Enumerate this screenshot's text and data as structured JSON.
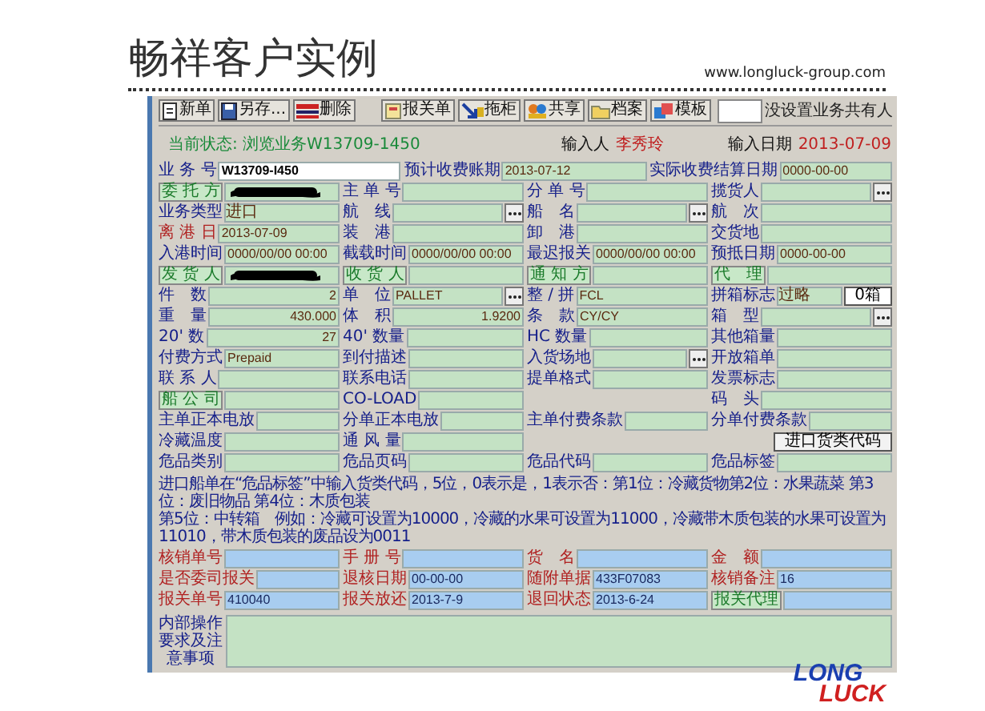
{
  "slide": {
    "title": "畅祥客户实例",
    "url": "www.longluck-group.com"
  },
  "toolbar": {
    "buttons": [
      "新单",
      "另存...",
      "删除",
      "报关单",
      "拖柜",
      "共享",
      "档案",
      "模板"
    ],
    "owner_note": "没设置业务共有人"
  },
  "status": {
    "text": "当前状态: 浏览业务W13709-1450",
    "input_by_label": "输入人",
    "input_by": "李秀玲",
    "input_date_label": "输入日期",
    "input_date": "2013-07-09"
  },
  "form_rows": [
    {
      "pairs": [
        {
          "kind": "field",
          "label": "业 务 号",
          "value": "W13709-I450",
          "focused": true
        },
        {
          "kind": "field",
          "label": "预计收费账期",
          "value": "2013-07-12"
        },
        {
          "kind": "field",
          "label": "实际收费结算日期",
          "value": "0000-00-00"
        }
      ]
    },
    {
      "pairs": [
        {
          "kind": "party",
          "label": "委 托 方",
          "redacted": true
        },
        {
          "kind": "field",
          "label": "主 单 号"
        },
        {
          "kind": "field",
          "label": "分 单 号"
        },
        {
          "kind": "field",
          "label": "揽货人",
          "browse": true
        }
      ]
    },
    {
      "pairs": [
        {
          "kind": "field",
          "label": "业务类型",
          "value": "进口"
        },
        {
          "kind": "field",
          "label": "航　线",
          "browse": true
        },
        {
          "kind": "field",
          "label": "船　名",
          "browse": true
        },
        {
          "kind": "field",
          "label": "航　次"
        }
      ]
    },
    {
      "pairs": [
        {
          "kind": "alert",
          "label": "离 港 日",
          "value": "2013-07-09"
        },
        {
          "kind": "field",
          "label": "装　港"
        },
        {
          "kind": "field",
          "label": "卸　港"
        },
        {
          "kind": "field",
          "label": "交货地"
        }
      ]
    },
    {
      "pairs": [
        {
          "kind": "field",
          "label": "入港时间",
          "value": "0000/00/00 00:00"
        },
        {
          "kind": "field",
          "label": "截载时间",
          "value": "0000/00/00 00:00"
        },
        {
          "kind": "field",
          "label": "最迟报关",
          "value": "0000/00/00 00:00"
        },
        {
          "kind": "field",
          "label": "预抵日期",
          "value": "0000-00-00"
        }
      ]
    },
    {
      "pairs": [
        {
          "kind": "party",
          "label": "发 货 人",
          "redacted": true
        },
        {
          "kind": "party",
          "label": "收 货 人"
        },
        {
          "kind": "party",
          "label": "通 知 方"
        },
        {
          "kind": "party",
          "label": "代　理"
        }
      ]
    },
    {
      "pairs": [
        {
          "kind": "field",
          "label": "件　数",
          "value": "2",
          "numeric": true
        },
        {
          "kind": "field",
          "label": "单　位",
          "value": "PALLET",
          "browse": true
        },
        {
          "kind": "field",
          "label": "整 / 拼",
          "value": "FCL"
        },
        {
          "kind": "field",
          "label": "拼箱标志",
          "value": "过略",
          "extra_button": "0箱"
        }
      ]
    },
    {
      "pairs": [
        {
          "kind": "field",
          "label": "重　量",
          "value": "430.000",
          "numeric": true
        },
        {
          "kind": "field",
          "label": "体　积",
          "value": "1.9200",
          "numeric": true
        },
        {
          "kind": "field",
          "label": "条　款",
          "value": "CY/CY"
        },
        {
          "kind": "field",
          "label": "箱　型",
          "browse": true
        }
      ]
    },
    {
      "pairs": [
        {
          "kind": "field",
          "label": "20' 数",
          "value": "27",
          "numeric": true
        },
        {
          "kind": "field",
          "label": "40' 数量"
        },
        {
          "kind": "field",
          "label": "HC 数量"
        },
        {
          "kind": "field",
          "label": "其他箱量"
        }
      ]
    },
    {
      "pairs": [
        {
          "kind": "field",
          "label": "付费方式",
          "value": "Prepaid"
        },
        {
          "kind": "field",
          "label": "到付描述"
        },
        {
          "kind": "field",
          "label": "入货场地",
          "browse": true
        },
        {
          "kind": "field",
          "label": "开放箱单"
        }
      ]
    },
    {
      "pairs": [
        {
          "kind": "field",
          "label": "联 系 人"
        },
        {
          "kind": "field",
          "label": "联系电话"
        },
        {
          "kind": "field",
          "label": "提单格式"
        },
        {
          "kind": "field",
          "label": "发票标志"
        }
      ]
    },
    {
      "pairs": [
        {
          "kind": "party",
          "label": "船 公 司"
        },
        {
          "kind": "field",
          "label": "CO-LOAD"
        },
        {
          "kind": "spacer"
        },
        {
          "kind": "field",
          "label": "码　头"
        }
      ]
    },
    {
      "pairs": [
        {
          "kind": "field",
          "label": "主单正本电放"
        },
        {
          "kind": "field",
          "label": "分单正本电放"
        },
        {
          "kind": "field",
          "label": "主单付费条款"
        },
        {
          "kind": "field",
          "label": "分单付费条款"
        }
      ]
    },
    {
      "pairs": [
        {
          "kind": "field",
          "label": "冷藏温度"
        },
        {
          "kind": "field",
          "label": "通 风 量"
        },
        {
          "kind": "spacer"
        },
        {
          "kind": "action",
          "label": "进口货类代码"
        }
      ]
    },
    {
      "pairs": [
        {
          "kind": "field",
          "label": "危品类别"
        },
        {
          "kind": "field",
          "label": "危品页码"
        },
        {
          "kind": "field",
          "label": "危品代码"
        },
        {
          "kind": "field",
          "label": "危品标签"
        }
      ]
    }
  ],
  "notes": [
    "进口船单在“危品标签”中输入货类代码，5位，0表示是，1表示否：第1位：冷藏货物第2位：水果蔬菜 第3位：废旧物品 第4位：木质包装",
    "第5位：中转箱　例如：冷藏可设置为10000，冷藏的水果可设置为11000，冷藏带木质包装的水果可设置为11010，带木质包装的废品设为0011"
  ],
  "customs_rows": [
    {
      "pairs": [
        {
          "kind": "alert",
          "label": "核销单号"
        },
        {
          "kind": "alert",
          "label": "手 册 号"
        },
        {
          "kind": "alert",
          "label": "货　名"
        },
        {
          "kind": "alert",
          "label": "金　额"
        }
      ]
    },
    {
      "pairs": [
        {
          "kind": "alert",
          "label": "是否委司报关"
        },
        {
          "kind": "alert",
          "label": "退核日期",
          "value": "00-00-00"
        },
        {
          "kind": "alert",
          "label": "随附单据",
          "value": "433F07083"
        },
        {
          "kind": "alert",
          "label": "核销备注",
          "value": "16"
        }
      ]
    },
    {
      "pairs": [
        {
          "kind": "alert",
          "label": "报关单号",
          "value": "410040"
        },
        {
          "kind": "alert",
          "label": "报关放还",
          "value": "2013-7-9"
        },
        {
          "kind": "alert",
          "label": "退回状态",
          "value": "2013-6-24"
        },
        {
          "kind": "party",
          "label": "报关代理"
        }
      ]
    }
  ],
  "remarks": {
    "label": "内部操作要求及注意事项"
  },
  "logo": {
    "line1": "LONG",
    "line2": "LUCK"
  }
}
